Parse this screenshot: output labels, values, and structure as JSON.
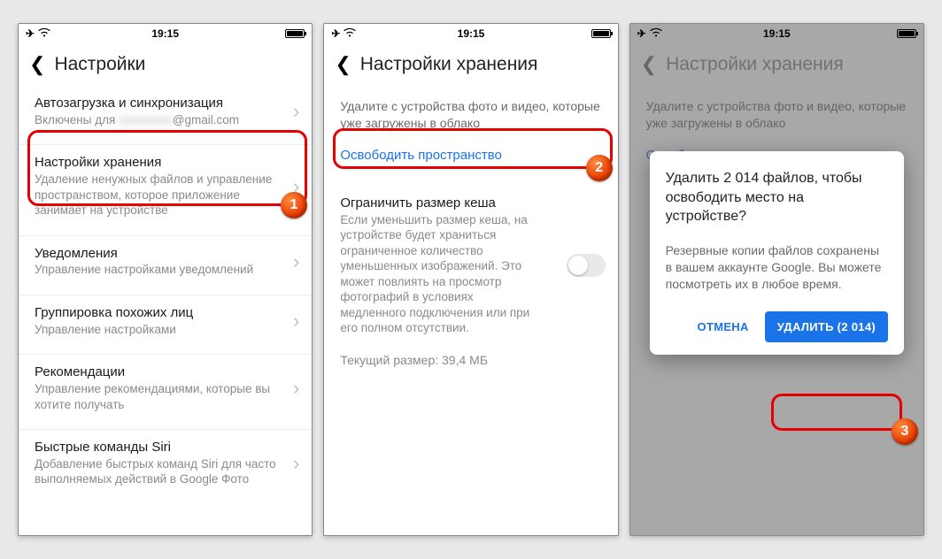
{
  "status": {
    "time": "19:15"
  },
  "markers": {
    "one": "1",
    "two": "2",
    "three": "3"
  },
  "screen1": {
    "header": "Настройки",
    "rows": {
      "autoload": {
        "title": "Автозагрузка и синхронизация",
        "sub_prefix": "Включены для ",
        "sub_email": "@gmail.com",
        "sub_blurred": "xxxxxxxxx"
      },
      "storage": {
        "title": "Настройки хранения",
        "sub": "Удаление ненужных файлов и управление пространством, которое приложение занимает на устройстве"
      },
      "notifications": {
        "title": "Уведомления",
        "sub": "Управление настройками уведомлений"
      },
      "faces": {
        "title": "Группировка похожих лиц",
        "sub": "Управление настройками"
      },
      "recs": {
        "title": "Рекомендации",
        "sub": "Управление рекомендациями, которые вы хотите получать"
      },
      "siri": {
        "title": "Быстрые команды Siri",
        "sub": "Добавление быстрых команд Siri для часто выполняемых действий в Google Фото"
      }
    }
  },
  "screen2": {
    "header": "Настройки хранения",
    "helper": "Удалите с устройства фото и видео, которые уже загружены в облако",
    "free_space": "Освободить пространство",
    "cache": {
      "title": "Ограничить размер кеша",
      "sub": "Если уменьшить размер кеша, на устройстве будет храниться ограниченное количество уменьшенных изображений. Это может повлиять на просмотр фотографий в условиях медленного подключения или при его полном отсутствии.",
      "size": "Текущий размер: 39,4 МБ"
    }
  },
  "screen3": {
    "header": "Настройки хранения",
    "helper": "Удалите с устройства фото и видео, которые уже загружены в облако",
    "free_space": "Освободить пространство",
    "dialog": {
      "title": "Удалить 2 014 файлов, чтобы освободить место на устройстве?",
      "body": "Резервные копии файлов сохранены в вашем аккаунте Google. Вы можете посмотреть их в любое время.",
      "cancel": "ОТМЕНА",
      "confirm": "УДАЛИТЬ (2 014)"
    }
  }
}
